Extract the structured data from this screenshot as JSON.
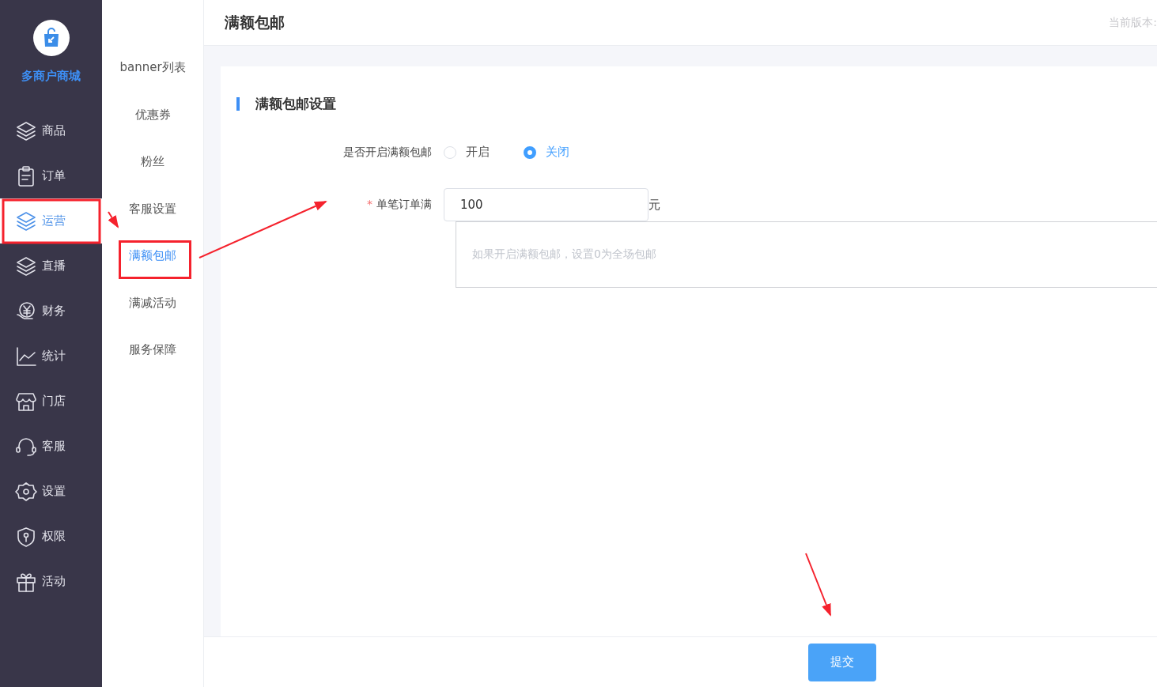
{
  "brand": {
    "name": "多商户商城"
  },
  "sidebar": {
    "items": [
      {
        "label": "商品",
        "selected": false
      },
      {
        "label": "订单",
        "selected": false
      },
      {
        "label": "运营",
        "selected": true
      },
      {
        "label": "直播",
        "selected": false
      },
      {
        "label": "财务",
        "selected": false
      },
      {
        "label": "统计",
        "selected": false
      },
      {
        "label": "门店",
        "selected": false
      },
      {
        "label": "客服",
        "selected": false
      },
      {
        "label": "设置",
        "selected": false
      },
      {
        "label": "权限",
        "selected": false
      },
      {
        "label": "活动",
        "selected": false
      }
    ]
  },
  "submenu": {
    "items": [
      {
        "label": "banner列表",
        "selected": false
      },
      {
        "label": "优惠券",
        "selected": false
      },
      {
        "label": "粉丝",
        "selected": false
      },
      {
        "label": "客服设置",
        "selected": false
      },
      {
        "label": "满额包邮",
        "selected": true
      },
      {
        "label": "满减活动",
        "selected": false
      },
      {
        "label": "服务保障",
        "selected": false
      }
    ]
  },
  "header": {
    "title": "满额包邮",
    "version_label": "当前版本:"
  },
  "form": {
    "section_title": "满额包邮设置",
    "enable": {
      "label": "是否开启满额包邮",
      "options": [
        {
          "label": "开启",
          "selected": false
        },
        {
          "label": "关闭",
          "selected": true
        }
      ]
    },
    "amount": {
      "label": "单笔订单满",
      "required_mark": "*",
      "value": "100",
      "unit": "元"
    },
    "hint": "如果开启满额包邮，设置0为全场包邮"
  },
  "footer": {
    "submit": "提交"
  }
}
